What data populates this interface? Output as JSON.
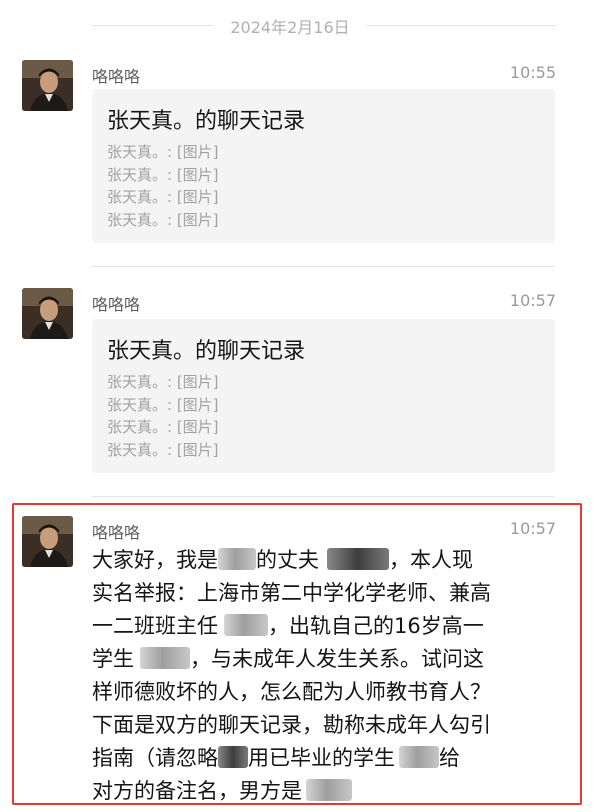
{
  "date_divider": "2024年2月16日",
  "messages": [
    {
      "sender": "咯咯咯",
      "time": "10:55",
      "card": {
        "title": "张天真。的聊天记录",
        "lines": [
          "张天真。: [图片]",
          "张天真。: [图片]",
          "张天真。: [图片]",
          "张天真。: [图片]"
        ]
      }
    },
    {
      "sender": "咯咯咯",
      "time": "10:57",
      "card": {
        "title": "张天真。的聊天记录",
        "lines": [
          "张天真。: [图片]",
          "张天真。: [图片]",
          "张天真。: [图片]",
          "张天真。: [图片]"
        ]
      }
    },
    {
      "sender": "咯咯咯",
      "time": "10:57",
      "text": {
        "l1a": "大家好，我是",
        "l1b": "的丈夫",
        "l1c": "，本人现",
        "l2": "实名举报：上海市第二中学化学老师、兼高",
        "l3a": "一二班班主任",
        "l3b": "，出轨自己的16岁高一",
        "l4a": "学生",
        "l4b": "，与未成年人发生关系。试问这",
        "l5": "样师德败坏的人，怎么配为人师教书育人？",
        "l6": "下面是双方的聊天记录，勘称未成年人勾引",
        "l7a": "指南（请忽略",
        "l7b": "用已毕业的学生",
        "l7c": "给",
        "l8a": "对方的备注名，男方是"
      }
    }
  ],
  "colors": {
    "highlight_border": "#e53935",
    "card_bg": "#f4f4f4"
  }
}
